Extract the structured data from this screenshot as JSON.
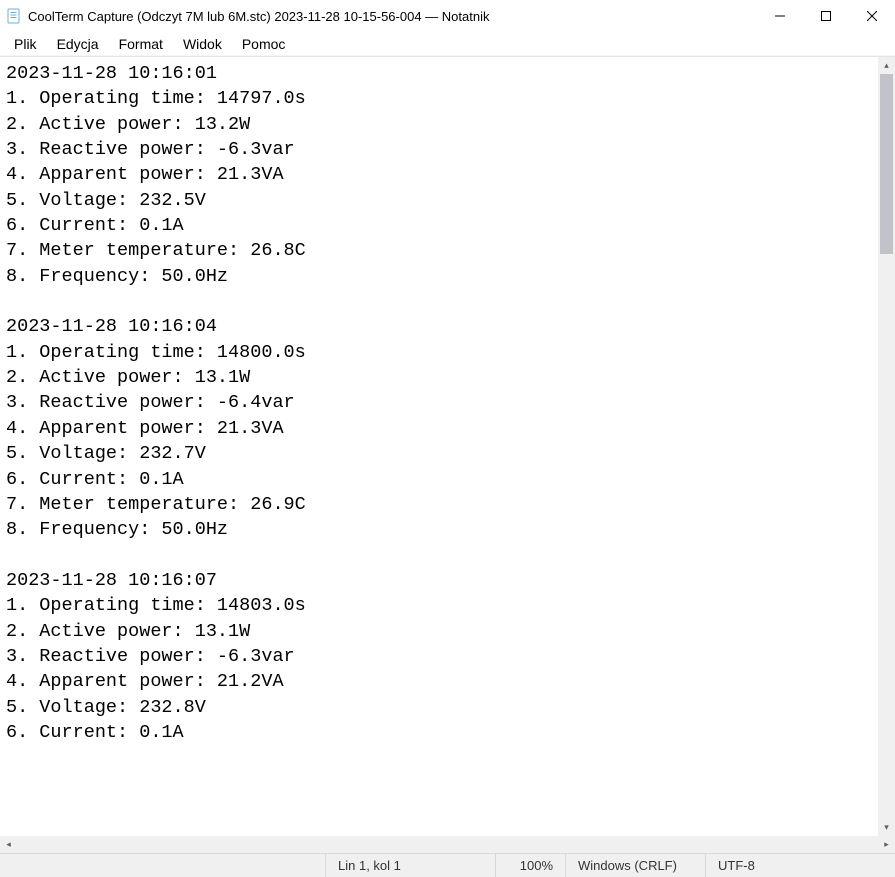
{
  "titlebar": {
    "title": "CoolTerm Capture (Odczyt 7M lub 6M.stc) 2023-11-28 10-15-56-004 — Notatnik"
  },
  "menu": {
    "items": [
      "Plik",
      "Edycja",
      "Format",
      "Widok",
      "Pomoc"
    ]
  },
  "records": [
    {
      "timestamp": "2023-11-28 10:16:01",
      "lines": [
        "1. Operating time: 14797.0s",
        "2. Active power: 13.2W",
        "3. Reactive power: -6.3var",
        "4. Apparent power: 21.3VA",
        "5. Voltage: 232.5V",
        "6. Current: 0.1A",
        "7. Meter temperature: 26.8C",
        "8. Frequency: 50.0Hz"
      ]
    },
    {
      "timestamp": "2023-11-28 10:16:04",
      "lines": [
        "1. Operating time: 14800.0s",
        "2. Active power: 13.1W",
        "3. Reactive power: -6.4var",
        "4. Apparent power: 21.3VA",
        "5. Voltage: 232.7V",
        "6. Current: 0.1A",
        "7. Meter temperature: 26.9C",
        "8. Frequency: 50.0Hz"
      ]
    },
    {
      "timestamp": "2023-11-28 10:16:07",
      "lines": [
        "1. Operating time: 14803.0s",
        "2. Active power: 13.1W",
        "3. Reactive power: -6.3var",
        "4. Apparent power: 21.2VA",
        "5. Voltage: 232.8V",
        "6. Current: 0.1A"
      ]
    }
  ],
  "status": {
    "position": "Lin 1, kol 1",
    "zoom": "100%",
    "eol": "Windows (CRLF)",
    "encoding": "UTF-8"
  }
}
